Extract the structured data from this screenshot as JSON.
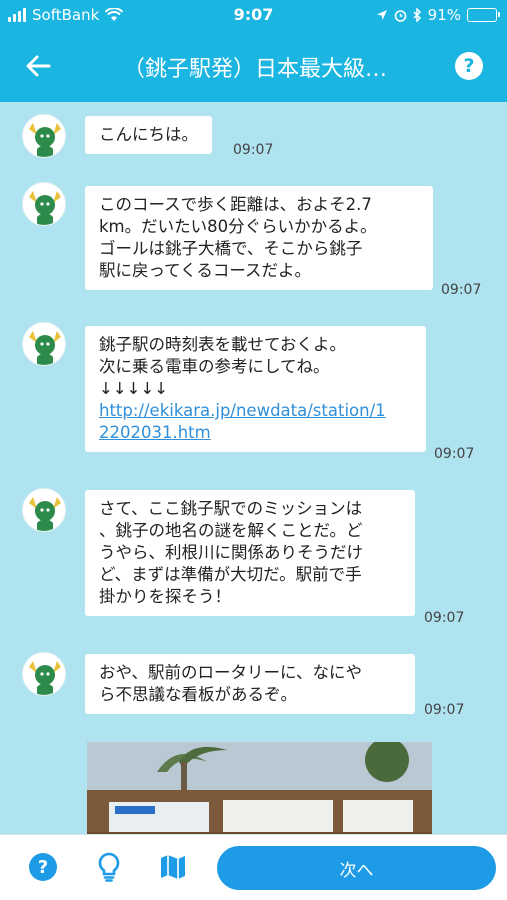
{
  "status_bar": {
    "carrier": "SoftBank",
    "time": "9:07",
    "battery_text": "91%",
    "battery_level": 0.91,
    "icons": [
      "signal-icon",
      "wifi-icon",
      "location-icon",
      "alarm-icon",
      "bluetooth-icon",
      "battery-icon"
    ]
  },
  "header": {
    "title": "（銚子駅発）日本最大級…",
    "back_icon": "arrow-left-icon",
    "help_label": "?"
  },
  "messages": [
    {
      "lines": [
        "こんにちは。"
      ],
      "time": "09:07"
    },
    {
      "lines": [
        "このコースで歩く距離は、およそ2.7",
        "km。だいたい80分ぐらいかかるよ。",
        "ゴールは銚子大橋で、そこから銚子",
        "駅に戻ってくるコースだよ。"
      ],
      "time": "09:07"
    },
    {
      "lines": [
        "銚子駅の時刻表を載せておくよ。",
        "次に乗る電車の参考にしてね。",
        "↓↓↓↓↓"
      ],
      "link_lines": [
        "http://ekikara.jp/newdata/station/1",
        "2202031.htm"
      ],
      "time": "09:07"
    },
    {
      "lines": [
        "さて、ここ銚子駅でのミッションは",
        "、銚子の地名の謎を解くことだ。ど",
        "うやら、利根川に関係ありそうだけ",
        "ど、まずは準備が大切だ。駅前で手",
        "掛かりを探そう！"
      ],
      "time": "09:07"
    },
    {
      "lines": [
        "おや、駅前のロータリーに、なにや",
        "ら不思議な看板があるぞ。"
      ],
      "time": "09:07"
    }
  ],
  "bottom_bar": {
    "help_label": "?",
    "hint_icon": "lightbulb-icon",
    "map_icon": "map-icon",
    "next_label": "次へ"
  },
  "colors": {
    "header_bg": "#1bb5e1",
    "chat_bg": "#aee3ef",
    "next_button": "#1e9be6",
    "link": "#2f8fd9"
  }
}
